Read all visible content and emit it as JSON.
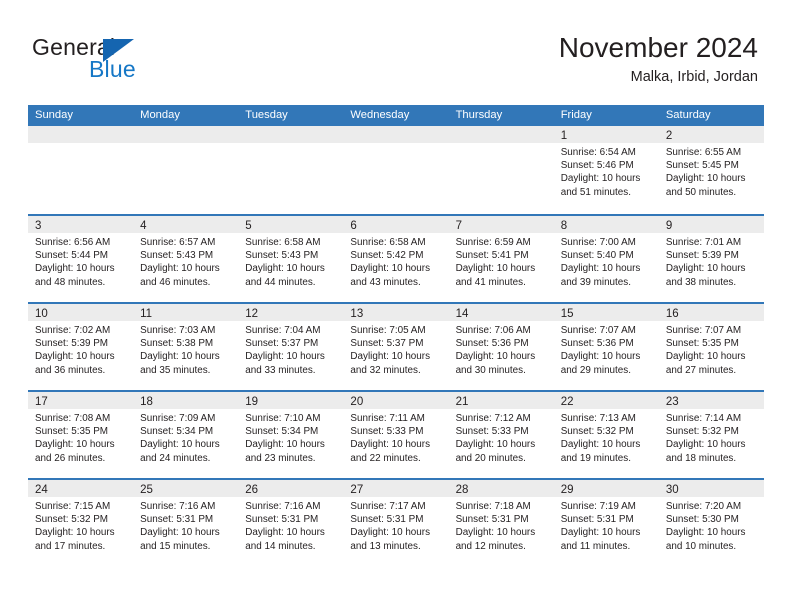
{
  "logo": {
    "word_one": "General",
    "word_two": "Blue",
    "triangle_color": "#1565b0",
    "blue_text_color": "#1577c6"
  },
  "header": {
    "title": "November 2024",
    "location": "Malka, Irbid, Jordan"
  },
  "theme": {
    "header_blue": "#3277b8",
    "day_strip_grey": "#ececec",
    "text": "#231f20"
  },
  "weekdays": [
    "Sunday",
    "Monday",
    "Tuesday",
    "Wednesday",
    "Thursday",
    "Friday",
    "Saturday"
  ],
  "weeks": [
    [
      {
        "day": "",
        "sunrise": "",
        "sunset": "",
        "daylight_line1": "",
        "daylight_line2": ""
      },
      {
        "day": "",
        "sunrise": "",
        "sunset": "",
        "daylight_line1": "",
        "daylight_line2": ""
      },
      {
        "day": "",
        "sunrise": "",
        "sunset": "",
        "daylight_line1": "",
        "daylight_line2": ""
      },
      {
        "day": "",
        "sunrise": "",
        "sunset": "",
        "daylight_line1": "",
        "daylight_line2": ""
      },
      {
        "day": "",
        "sunrise": "",
        "sunset": "",
        "daylight_line1": "",
        "daylight_line2": ""
      },
      {
        "day": "1",
        "sunrise": "Sunrise: 6:54 AM",
        "sunset": "Sunset: 5:46 PM",
        "daylight_line1": "Daylight: 10 hours",
        "daylight_line2": "and 51 minutes."
      },
      {
        "day": "2",
        "sunrise": "Sunrise: 6:55 AM",
        "sunset": "Sunset: 5:45 PM",
        "daylight_line1": "Daylight: 10 hours",
        "daylight_line2": "and 50 minutes."
      }
    ],
    [
      {
        "day": "3",
        "sunrise": "Sunrise: 6:56 AM",
        "sunset": "Sunset: 5:44 PM",
        "daylight_line1": "Daylight: 10 hours",
        "daylight_line2": "and 48 minutes."
      },
      {
        "day": "4",
        "sunrise": "Sunrise: 6:57 AM",
        "sunset": "Sunset: 5:43 PM",
        "daylight_line1": "Daylight: 10 hours",
        "daylight_line2": "and 46 minutes."
      },
      {
        "day": "5",
        "sunrise": "Sunrise: 6:58 AM",
        "sunset": "Sunset: 5:43 PM",
        "daylight_line1": "Daylight: 10 hours",
        "daylight_line2": "and 44 minutes."
      },
      {
        "day": "6",
        "sunrise": "Sunrise: 6:58 AM",
        "sunset": "Sunset: 5:42 PM",
        "daylight_line1": "Daylight: 10 hours",
        "daylight_line2": "and 43 minutes."
      },
      {
        "day": "7",
        "sunrise": "Sunrise: 6:59 AM",
        "sunset": "Sunset: 5:41 PM",
        "daylight_line1": "Daylight: 10 hours",
        "daylight_line2": "and 41 minutes."
      },
      {
        "day": "8",
        "sunrise": "Sunrise: 7:00 AM",
        "sunset": "Sunset: 5:40 PM",
        "daylight_line1": "Daylight: 10 hours",
        "daylight_line2": "and 39 minutes."
      },
      {
        "day": "9",
        "sunrise": "Sunrise: 7:01 AM",
        "sunset": "Sunset: 5:39 PM",
        "daylight_line1": "Daylight: 10 hours",
        "daylight_line2": "and 38 minutes."
      }
    ],
    [
      {
        "day": "10",
        "sunrise": "Sunrise: 7:02 AM",
        "sunset": "Sunset: 5:39 PM",
        "daylight_line1": "Daylight: 10 hours",
        "daylight_line2": "and 36 minutes."
      },
      {
        "day": "11",
        "sunrise": "Sunrise: 7:03 AM",
        "sunset": "Sunset: 5:38 PM",
        "daylight_line1": "Daylight: 10 hours",
        "daylight_line2": "and 35 minutes."
      },
      {
        "day": "12",
        "sunrise": "Sunrise: 7:04 AM",
        "sunset": "Sunset: 5:37 PM",
        "daylight_line1": "Daylight: 10 hours",
        "daylight_line2": "and 33 minutes."
      },
      {
        "day": "13",
        "sunrise": "Sunrise: 7:05 AM",
        "sunset": "Sunset: 5:37 PM",
        "daylight_line1": "Daylight: 10 hours",
        "daylight_line2": "and 32 minutes."
      },
      {
        "day": "14",
        "sunrise": "Sunrise: 7:06 AM",
        "sunset": "Sunset: 5:36 PM",
        "daylight_line1": "Daylight: 10 hours",
        "daylight_line2": "and 30 minutes."
      },
      {
        "day": "15",
        "sunrise": "Sunrise: 7:07 AM",
        "sunset": "Sunset: 5:36 PM",
        "daylight_line1": "Daylight: 10 hours",
        "daylight_line2": "and 29 minutes."
      },
      {
        "day": "16",
        "sunrise": "Sunrise: 7:07 AM",
        "sunset": "Sunset: 5:35 PM",
        "daylight_line1": "Daylight: 10 hours",
        "daylight_line2": "and 27 minutes."
      }
    ],
    [
      {
        "day": "17",
        "sunrise": "Sunrise: 7:08 AM",
        "sunset": "Sunset: 5:35 PM",
        "daylight_line1": "Daylight: 10 hours",
        "daylight_line2": "and 26 minutes."
      },
      {
        "day": "18",
        "sunrise": "Sunrise: 7:09 AM",
        "sunset": "Sunset: 5:34 PM",
        "daylight_line1": "Daylight: 10 hours",
        "daylight_line2": "and 24 minutes."
      },
      {
        "day": "19",
        "sunrise": "Sunrise: 7:10 AM",
        "sunset": "Sunset: 5:34 PM",
        "daylight_line1": "Daylight: 10 hours",
        "daylight_line2": "and 23 minutes."
      },
      {
        "day": "20",
        "sunrise": "Sunrise: 7:11 AM",
        "sunset": "Sunset: 5:33 PM",
        "daylight_line1": "Daylight: 10 hours",
        "daylight_line2": "and 22 minutes."
      },
      {
        "day": "21",
        "sunrise": "Sunrise: 7:12 AM",
        "sunset": "Sunset: 5:33 PM",
        "daylight_line1": "Daylight: 10 hours",
        "daylight_line2": "and 20 minutes."
      },
      {
        "day": "22",
        "sunrise": "Sunrise: 7:13 AM",
        "sunset": "Sunset: 5:32 PM",
        "daylight_line1": "Daylight: 10 hours",
        "daylight_line2": "and 19 minutes."
      },
      {
        "day": "23",
        "sunrise": "Sunrise: 7:14 AM",
        "sunset": "Sunset: 5:32 PM",
        "daylight_line1": "Daylight: 10 hours",
        "daylight_line2": "and 18 minutes."
      }
    ],
    [
      {
        "day": "24",
        "sunrise": "Sunrise: 7:15 AM",
        "sunset": "Sunset: 5:32 PM",
        "daylight_line1": "Daylight: 10 hours",
        "daylight_line2": "and 17 minutes."
      },
      {
        "day": "25",
        "sunrise": "Sunrise: 7:16 AM",
        "sunset": "Sunset: 5:31 PM",
        "daylight_line1": "Daylight: 10 hours",
        "daylight_line2": "and 15 minutes."
      },
      {
        "day": "26",
        "sunrise": "Sunrise: 7:16 AM",
        "sunset": "Sunset: 5:31 PM",
        "daylight_line1": "Daylight: 10 hours",
        "daylight_line2": "and 14 minutes."
      },
      {
        "day": "27",
        "sunrise": "Sunrise: 7:17 AM",
        "sunset": "Sunset: 5:31 PM",
        "daylight_line1": "Daylight: 10 hours",
        "daylight_line2": "and 13 minutes."
      },
      {
        "day": "28",
        "sunrise": "Sunrise: 7:18 AM",
        "sunset": "Sunset: 5:31 PM",
        "daylight_line1": "Daylight: 10 hours",
        "daylight_line2": "and 12 minutes."
      },
      {
        "day": "29",
        "sunrise": "Sunrise: 7:19 AM",
        "sunset": "Sunset: 5:31 PM",
        "daylight_line1": "Daylight: 10 hours",
        "daylight_line2": "and 11 minutes."
      },
      {
        "day": "30",
        "sunrise": "Sunrise: 7:20 AM",
        "sunset": "Sunset: 5:30 PM",
        "daylight_line1": "Daylight: 10 hours",
        "daylight_line2": "and 10 minutes."
      }
    ]
  ]
}
